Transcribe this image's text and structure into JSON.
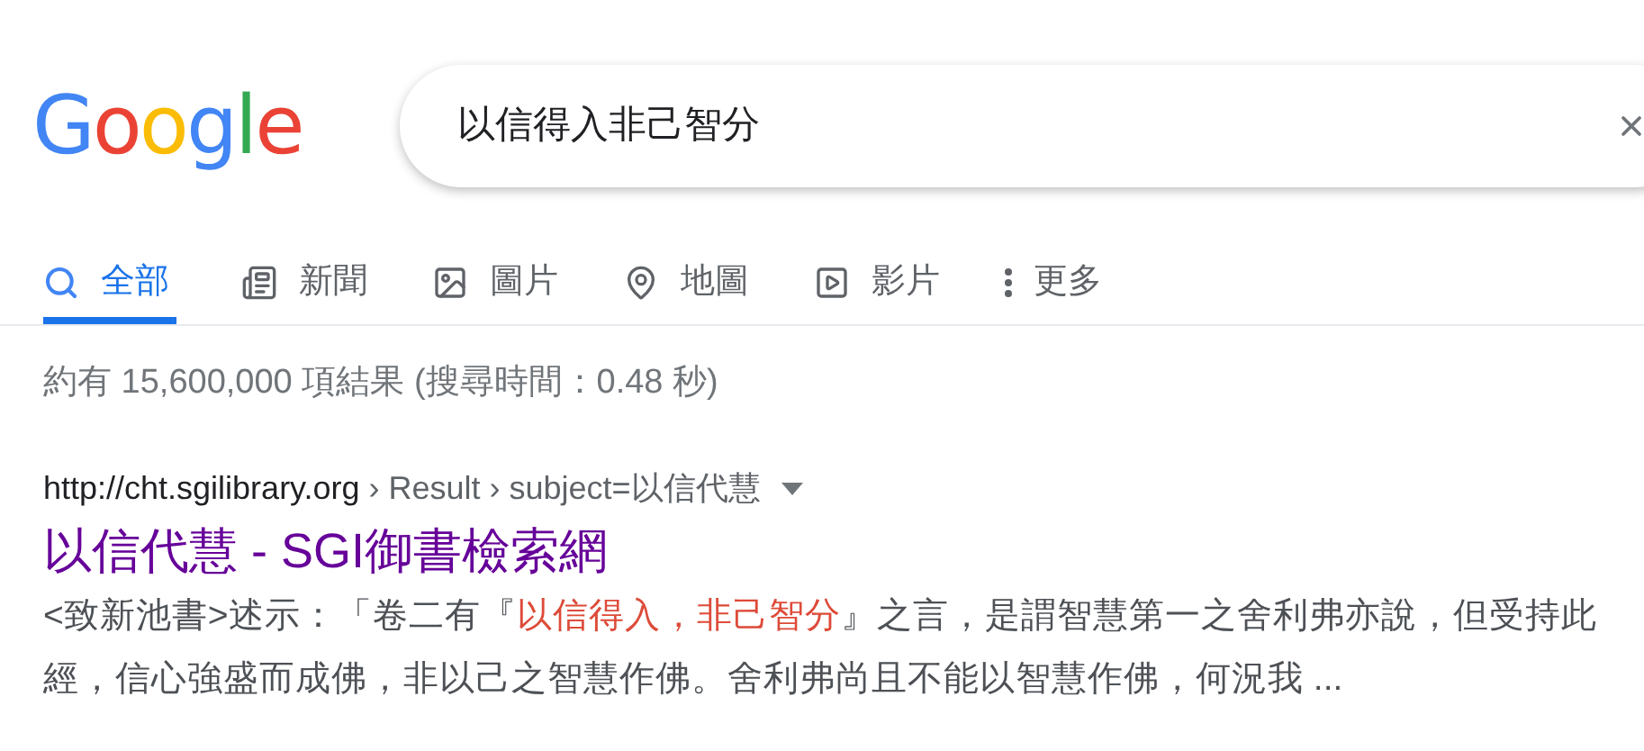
{
  "logo": "Google",
  "search": {
    "value": "以信得入非己智分"
  },
  "tabs": [
    {
      "label": "全部",
      "kind": "all",
      "selected": true
    },
    {
      "label": "新聞",
      "kind": "news",
      "selected": false
    },
    {
      "label": "圖片",
      "kind": "images",
      "selected": false
    },
    {
      "label": "地圖",
      "kind": "maps",
      "selected": false
    },
    {
      "label": "影片",
      "kind": "videos",
      "selected": false
    },
    {
      "label": "更多",
      "kind": "more",
      "selected": false
    }
  ],
  "stats": {
    "prefix": "約有",
    "count": "15,600,000",
    "middle": "項結果",
    "timing": "(搜尋時間：0.48 秒)"
  },
  "results": [
    {
      "url": "http://cht.sgilibrary.org",
      "breadcrumb": "› Result › subject=以信代慧",
      "title": "以信代慧 - SGI御書檢索網",
      "snippet": [
        {
          "text": "<致新池書>述示：「卷二有『",
          "highlight": false
        },
        {
          "text": "以信得入，非己智分",
          "highlight": true
        },
        {
          "text": "』之言，是謂智慧第一之舍利弗亦說，但受持此經，信心強盛而成佛，非以己之智慧作佛。舍利弗尚且不能以智慧作佛，何況我 ...",
          "highlight": false
        }
      ]
    }
  ]
}
